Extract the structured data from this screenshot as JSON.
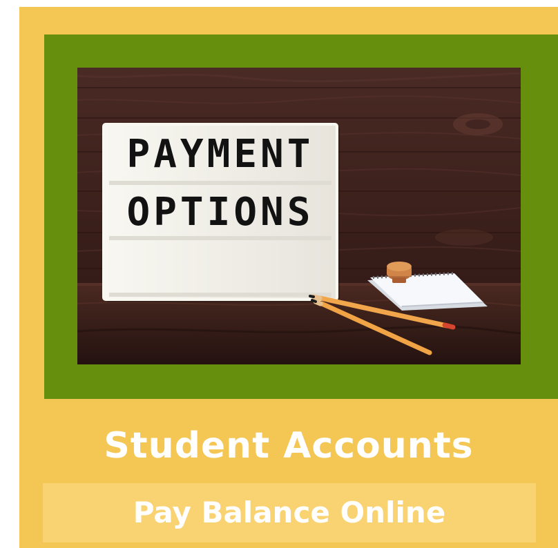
{
  "promo": {
    "lightbox_line_1": "PAYMENT",
    "lightbox_line_2": "OPTIONS",
    "title": "Student Accounts",
    "button_label": "Pay Balance Online"
  },
  "colors": {
    "card_background": "#f4c653",
    "frame_green": "#668f0e",
    "button_background": "#f9d271",
    "text": "#ffffff"
  }
}
